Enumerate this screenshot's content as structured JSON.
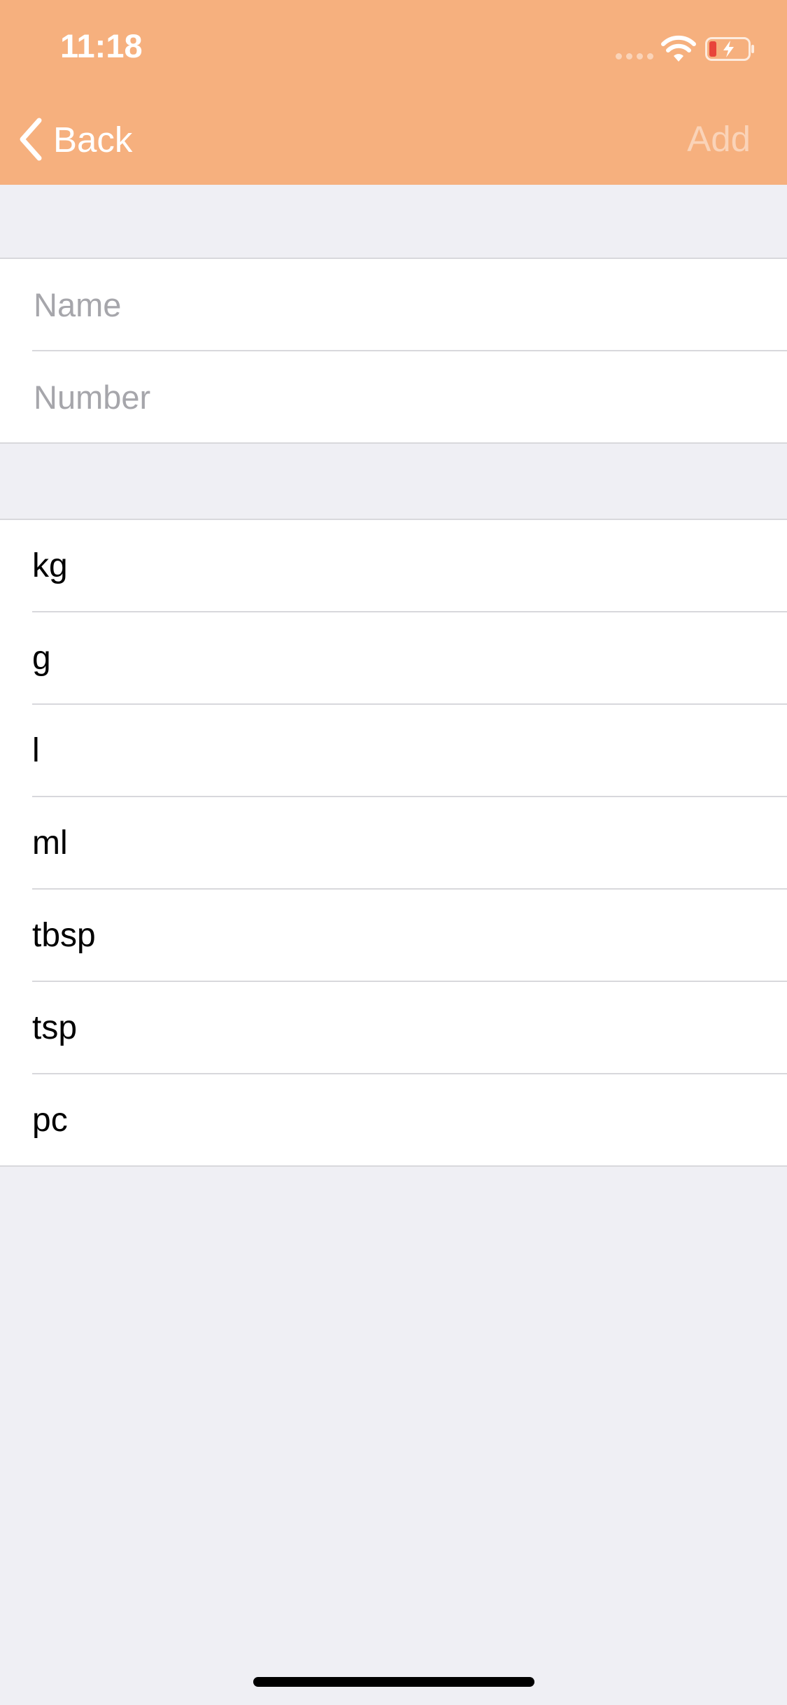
{
  "status_bar": {
    "time": "11:18",
    "icons": [
      "cellular-signal-icon",
      "wifi-icon",
      "battery-charging-icon"
    ]
  },
  "nav": {
    "back_label": "Back",
    "back_icon": "chevron-left-icon",
    "add_label": "Add",
    "bar_color": "#F6B07E"
  },
  "form": {
    "name_placeholder": "Name",
    "name_value": "",
    "number_placeholder": "Number",
    "number_value": ""
  },
  "units": {
    "items": [
      "kg",
      "g",
      "l",
      "ml",
      "tbsp",
      "tsp",
      "pc"
    ]
  },
  "colors": {
    "background": "#EFEFF4",
    "battery_low": "#E8443A"
  }
}
